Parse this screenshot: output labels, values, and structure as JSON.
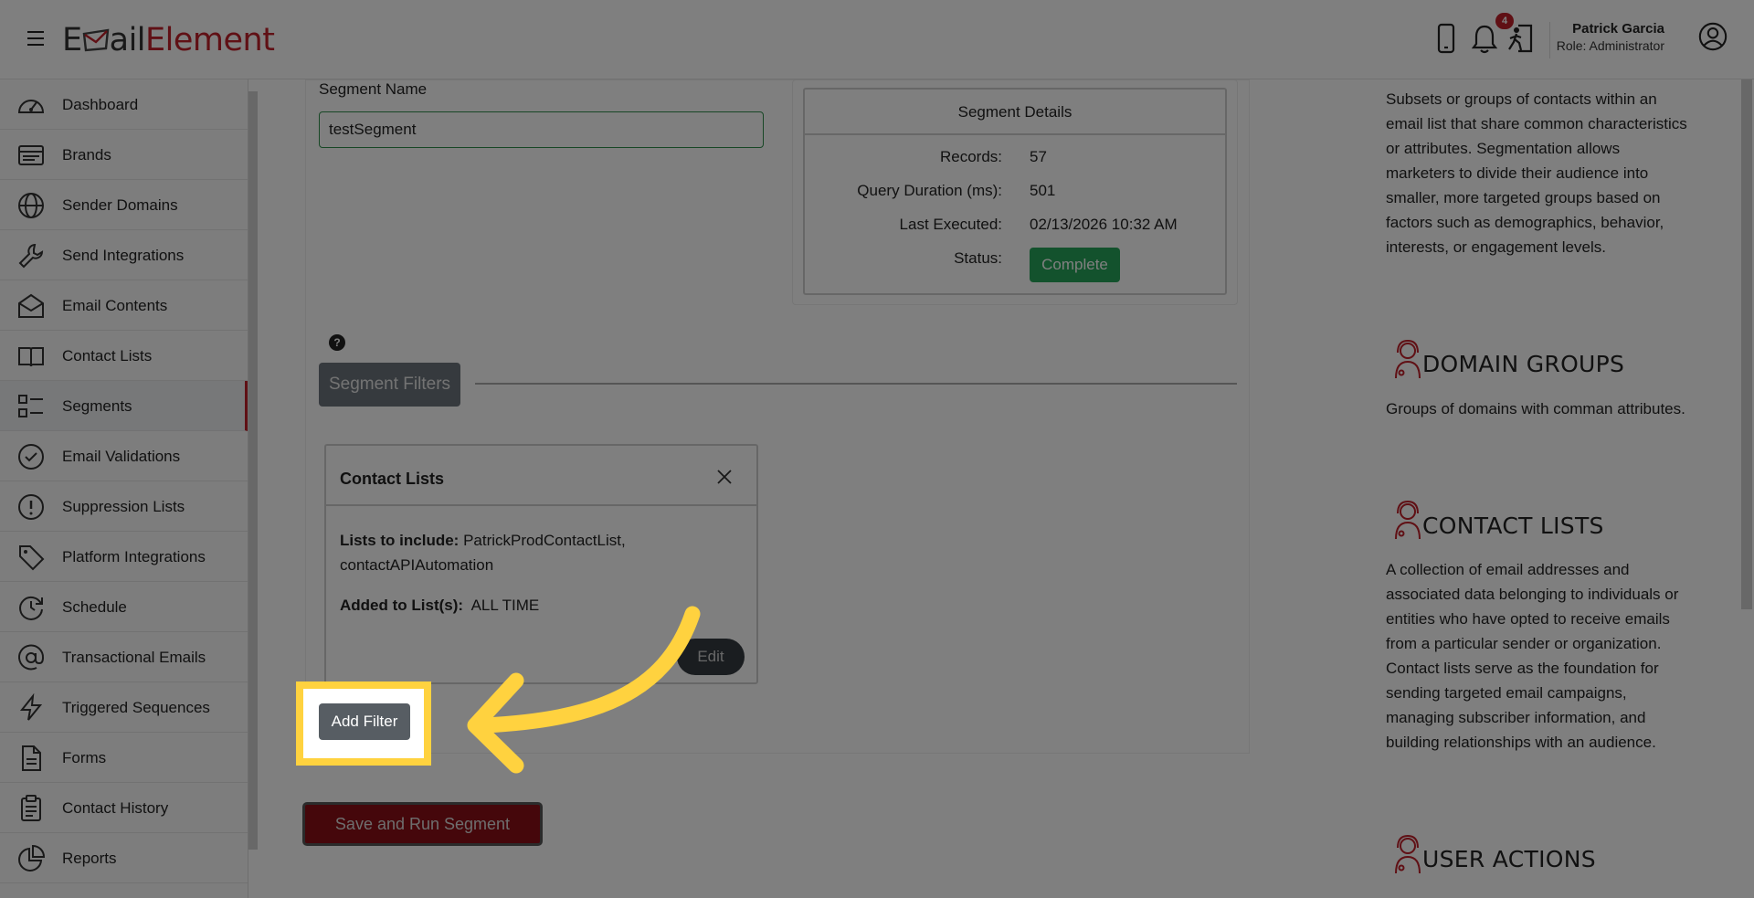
{
  "header": {
    "menu_icon": "hamburger-icon",
    "logo_part1": "E",
    "logo_mark": "envelope-m",
    "logo_part2": "ail",
    "logo_part3": "Element",
    "notification_count": "4",
    "user_name": "Patrick Garcia",
    "user_role": "Role: Administrator",
    "icons": [
      "mobile-icon",
      "bell-icon",
      "exit-icon",
      "user-circle-icon"
    ]
  },
  "sidebar": {
    "items": [
      {
        "label": "Dashboard",
        "icon": "dashboard-icon"
      },
      {
        "label": "Brands",
        "icon": "brands-icon"
      },
      {
        "label": "Sender Domains",
        "icon": "globe-icon"
      },
      {
        "label": "Send Integrations",
        "icon": "wrench-icon"
      },
      {
        "label": "Email Contents",
        "icon": "envelope-icon"
      },
      {
        "label": "Contact Lists",
        "icon": "book-icon"
      },
      {
        "label": "Segments",
        "icon": "segments-icon"
      },
      {
        "label": "Email Validations",
        "icon": "check-circle-icon"
      },
      {
        "label": "Suppression Lists",
        "icon": "alert-circle-icon"
      },
      {
        "label": "Platform Integrations",
        "icon": "tag-icon"
      },
      {
        "label": "Schedule",
        "icon": "clock-icon"
      },
      {
        "label": "Transactional Emails",
        "icon": "at-icon"
      },
      {
        "label": "Triggered Sequences",
        "icon": "bolt-icon"
      },
      {
        "label": "Forms",
        "icon": "file-icon"
      },
      {
        "label": "Contact History",
        "icon": "clipboard-icon"
      },
      {
        "label": "Reports",
        "icon": "pie-chart-icon"
      }
    ],
    "active_index": 6
  },
  "segment": {
    "name_label": "Segment Name",
    "name_value": "testSegment",
    "details": {
      "title": "Segment Details",
      "rows": [
        {
          "label": "Records:",
          "value": "57"
        },
        {
          "label": "Query Duration (ms):",
          "value": "501"
        },
        {
          "label": "Last Executed:",
          "value": "02/13/2026 10:32 AM"
        }
      ],
      "status_label": "Status:",
      "status_value": "Complete"
    },
    "help_glyph": "?",
    "filters_button": "Segment Filters",
    "contact_lists_card": {
      "title": "Contact Lists",
      "include_label": "Lists to include:",
      "include_value": "PatrickProdContactList, contactAPIAutomation",
      "added_label": "Added to List(s):",
      "added_value": "ALL TIME",
      "edit_button": "Edit"
    },
    "add_filter_button": "Add Filter",
    "save_button": "Save and Run Segment"
  },
  "right_panel": {
    "cards": [
      {
        "title": "",
        "text": "Subsets or groups of contacts within an email list that share common characteristics or attributes. Segmentation allows marketers to divide their audience into smaller, more targeted groups based on factors such as demographics, behavior, interests, or engagement levels."
      },
      {
        "title": "DOMAIN GROUPS",
        "text": "Groups of domains with comman attributes.",
        "icon": "support-agent-icon"
      },
      {
        "title": "CONTACT LISTS",
        "text": "A collection of email addresses and associated data belonging to individuals or entities who have opted to receive emails from a particular sender or organization. Contact lists serve as the foundation for sending targeted email campaigns, managing subscriber information, and building relationships with an audience.",
        "icon": "support-agent-icon"
      },
      {
        "title": "USER ACTIONS",
        "text": "",
        "icon": "support-agent-icon"
      }
    ]
  },
  "colors": {
    "brand_red": "#c0202a",
    "status_green": "#27a55a",
    "highlight_yellow": "#ffd23f",
    "overlay": "rgba(0,0,0,0.5)"
  }
}
